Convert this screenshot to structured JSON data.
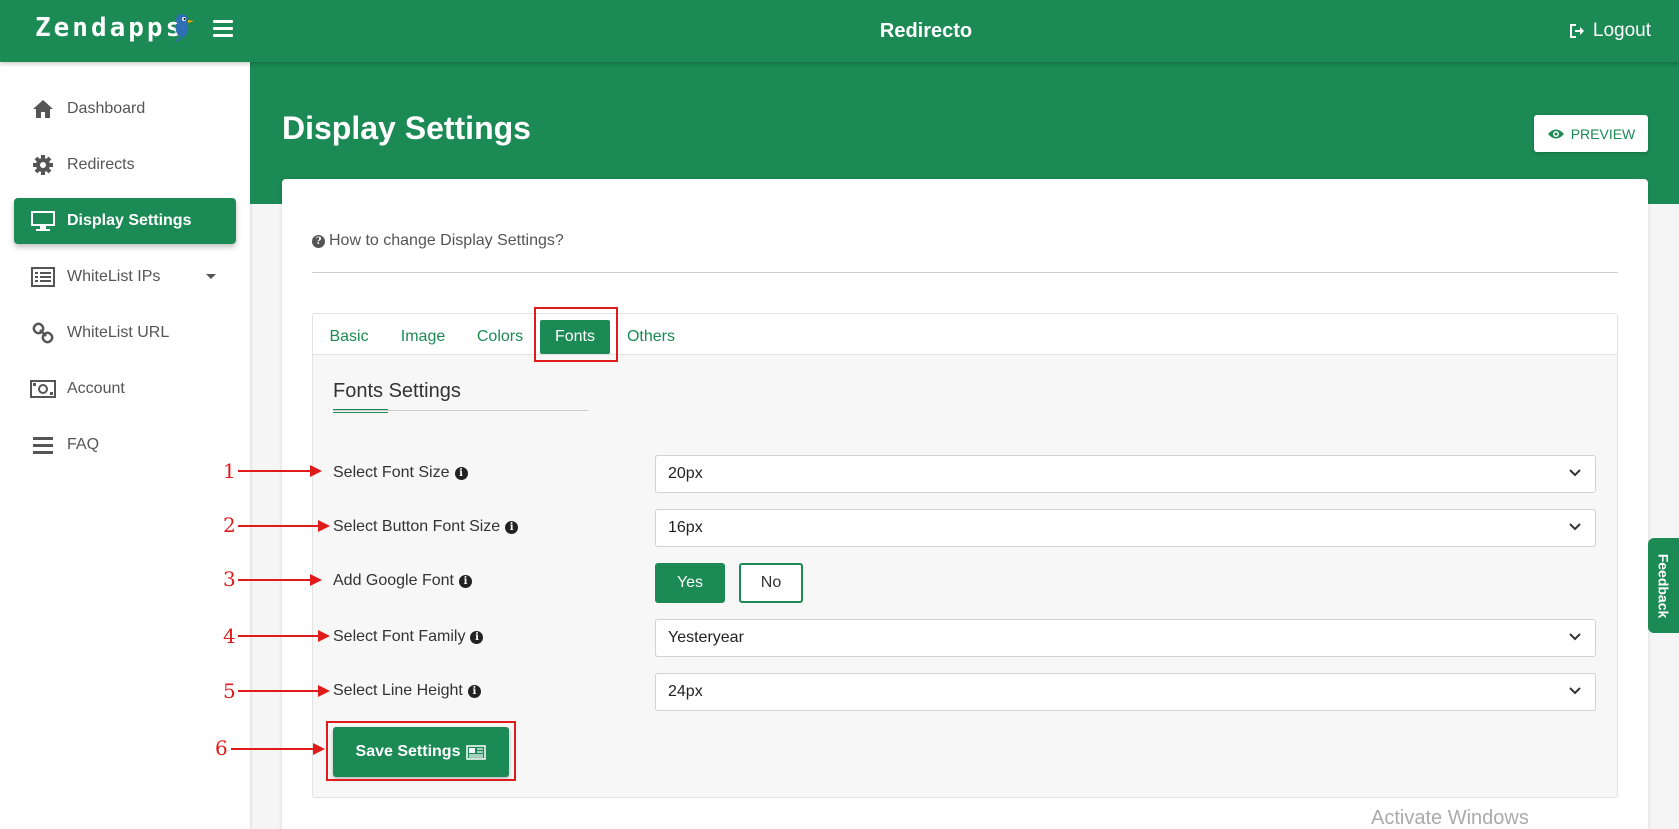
{
  "brand": {
    "name": "Zendapps"
  },
  "header": {
    "title": "Redirecto",
    "logout_label": "Logout"
  },
  "sidebar": {
    "items": [
      {
        "label": "Dashboard",
        "icon": "home-icon"
      },
      {
        "label": "Redirects",
        "icon": "gear-icon"
      },
      {
        "label": "Display Settings",
        "icon": "monitor-icon",
        "active": true
      },
      {
        "label": "WhiteList IPs",
        "icon": "list-icon",
        "has_submenu": true
      },
      {
        "label": "WhiteList URL",
        "icon": "link-icon"
      },
      {
        "label": "Account",
        "icon": "money-icon"
      },
      {
        "label": "FAQ",
        "icon": "bars-icon"
      }
    ]
  },
  "page": {
    "title": "Display Settings",
    "preview_label": "PREVIEW",
    "help_link": "How to change Display Settings?"
  },
  "tabs": [
    {
      "label": "Basic"
    },
    {
      "label": "Image"
    },
    {
      "label": "Colors"
    },
    {
      "label": "Fonts",
      "active": true
    },
    {
      "label": "Others"
    }
  ],
  "fonts_section": {
    "title": "Fonts Settings",
    "font_size": {
      "label": "Select Font Size",
      "value": "20px"
    },
    "button_font_size": {
      "label": "Select Button Font Size",
      "value": "16px"
    },
    "google_font": {
      "label": "Add Google Font",
      "yes_label": "Yes",
      "no_label": "No",
      "selected": "Yes"
    },
    "font_family": {
      "label": "Select Font Family",
      "value": "Yesteryear"
    },
    "line_height": {
      "label": "Select Line Height",
      "value": "24px"
    },
    "save_label": "Save Settings"
  },
  "annotations": [
    "1",
    "2",
    "3",
    "4",
    "5",
    "6"
  ],
  "feedback_label": "Feedback",
  "watermark": "Activate Windows",
  "colors": {
    "primary": "#1b8a54",
    "annotation": "#e01b1b"
  }
}
